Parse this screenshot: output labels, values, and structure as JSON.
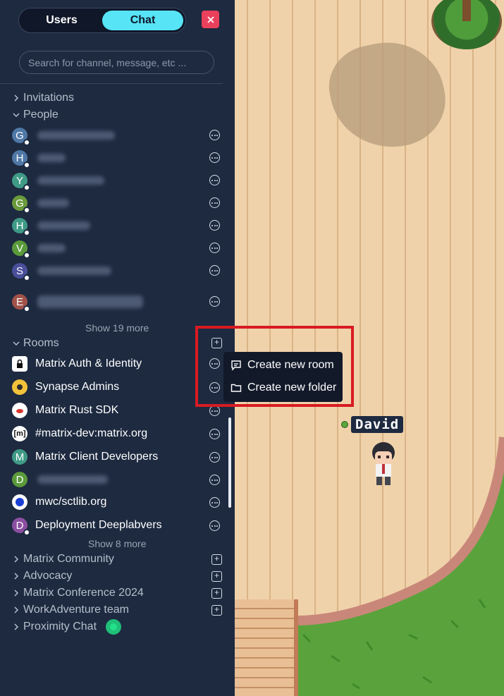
{
  "tabs": [
    {
      "label": "Users",
      "active": false
    },
    {
      "label": "Chat",
      "active": true
    }
  ],
  "close_icon": "close-icon",
  "search": {
    "placeholder": "Search for channel, message, etc ..."
  },
  "sections": {
    "invitations": "Invitations",
    "people": "People",
    "rooms": "Rooms"
  },
  "people": [
    {
      "initial": "G",
      "color": "#4f78a6"
    },
    {
      "initial": "H",
      "color": "#4f78a6"
    },
    {
      "initial": "Y",
      "color": "#3f9a86"
    },
    {
      "initial": "G",
      "color": "#6a9a3a"
    },
    {
      "initial": "H",
      "color": "#3f9a86"
    },
    {
      "initial": "V",
      "color": "#5a9a3a"
    },
    {
      "initial": "S",
      "color": "#4a4f9a"
    },
    {
      "initial": "E",
      "color": "#a0524a"
    }
  ],
  "people_show_more": "Show 19 more",
  "rooms": [
    {
      "name": "Matrix Auth & Identity",
      "icon": "lock-icon",
      "color": "#ffffff"
    },
    {
      "name": "Synapse Admins",
      "icon": "synapse-icon",
      "color": "#f2c23a"
    },
    {
      "name": "Matrix Rust SDK",
      "icon": "crab-icon",
      "color": "#ffffff"
    },
    {
      "name": "#matrix-dev:matrix.org",
      "icon": "matrix-icon",
      "color": "#ffffff"
    },
    {
      "name": "Matrix Client Developers",
      "icon": "M",
      "color": "#3f9a86"
    },
    {
      "name": "",
      "icon": "D",
      "color": "#5a9a3a"
    },
    {
      "name": "mwc/sctlib.org",
      "icon": "blue-circle-icon",
      "color": "#ffffff"
    },
    {
      "name": "Deployment Deeplabvers",
      "icon": "D",
      "color": "#8a4fa0"
    }
  ],
  "rooms_show_more": "Show 8 more",
  "folders": [
    {
      "name": "Matrix Community"
    },
    {
      "name": "Advocacy"
    },
    {
      "name": "Matrix Conference 2024"
    },
    {
      "name": "WorkAdventure team"
    },
    {
      "name": "Proximity Chat"
    }
  ],
  "context_menu": {
    "create_room": "Create new room",
    "create_folder": "Create new folder"
  },
  "player": {
    "name": "David"
  }
}
